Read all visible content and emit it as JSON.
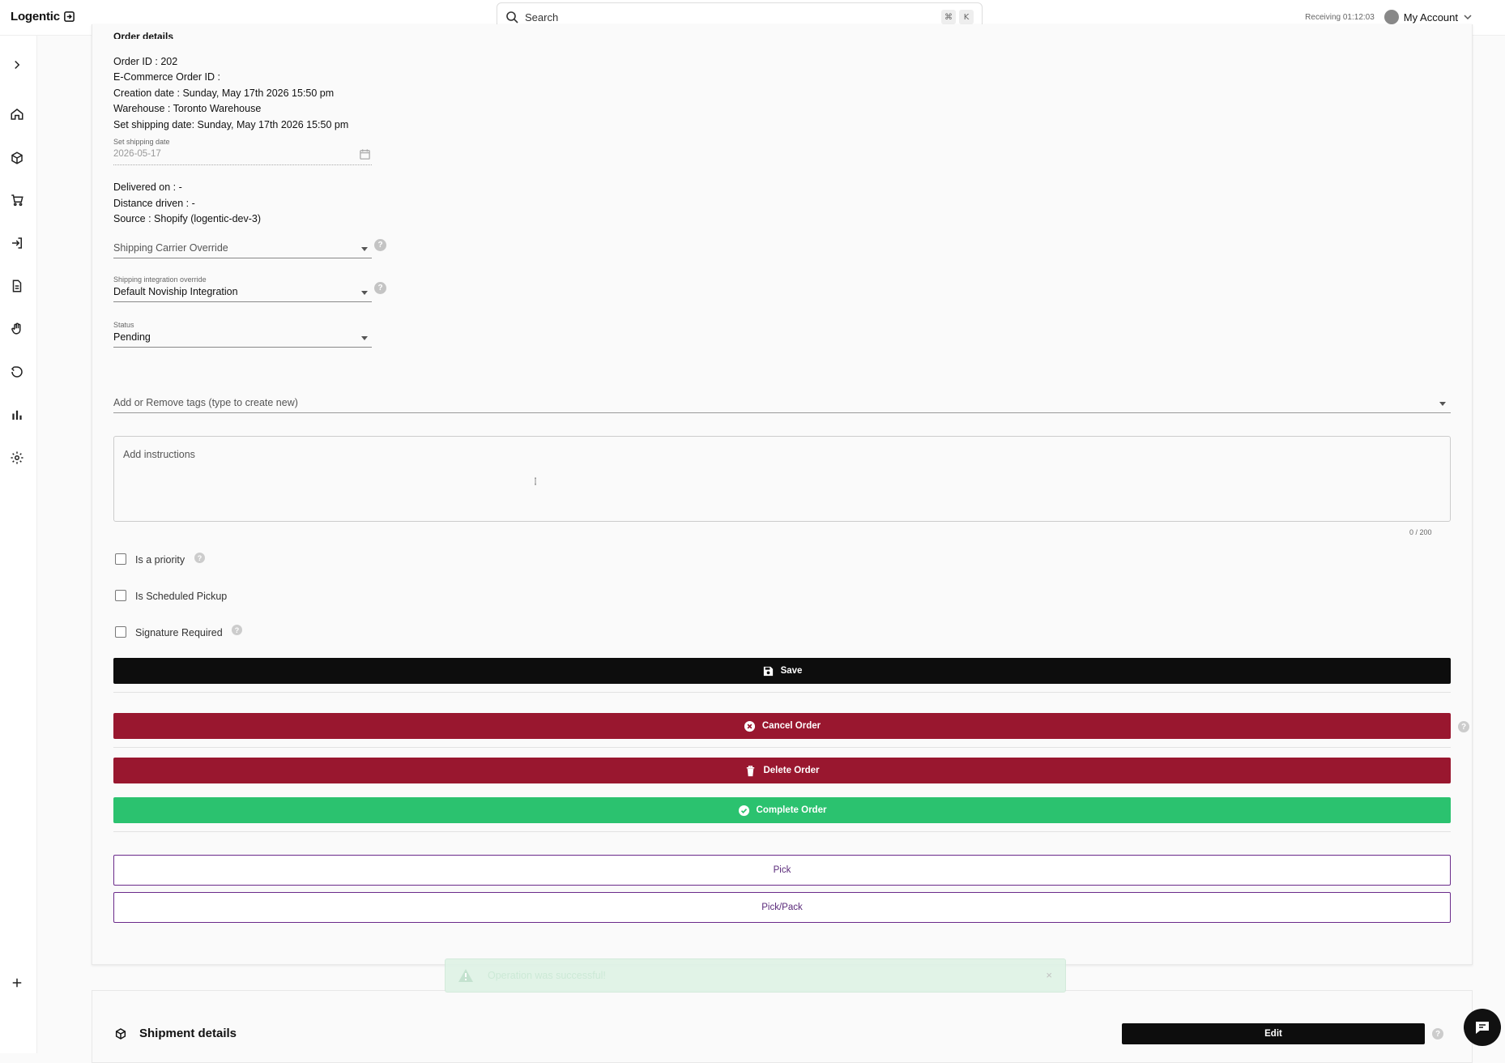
{
  "app": {
    "name": "Logentic"
  },
  "search": {
    "placeholder": "Search",
    "shortcut_cmd": "⌘",
    "shortcut_key": "K"
  },
  "header": {
    "receiving_label": "Receiving",
    "timer": "01:12:03",
    "account_label": "My Account"
  },
  "sidebar": {
    "items": [
      {
        "name": "expand",
        "icon": "chevron-right-icon"
      },
      {
        "name": "home",
        "icon": "home-icon"
      },
      {
        "name": "products",
        "icon": "box-icon"
      },
      {
        "name": "orders",
        "icon": "cart-icon"
      },
      {
        "name": "receiving",
        "icon": "login-icon"
      },
      {
        "name": "documents",
        "icon": "document-icon"
      },
      {
        "name": "picking",
        "icon": "hand-icon"
      },
      {
        "name": "returns",
        "icon": "undo-icon"
      },
      {
        "name": "reports",
        "icon": "bar-chart-icon"
      },
      {
        "name": "settings",
        "icon": "gear-icon"
      },
      {
        "name": "add",
        "icon": "plus-icon"
      }
    ]
  },
  "order": {
    "section_title": "Order details",
    "order_id": "Order ID : 202",
    "ecommerce_id": "E-Commerce Order ID :",
    "creation_date": "Creation date : Sunday, May 17th 2026 15:50 pm",
    "warehouse": "Warehouse : Toronto Warehouse",
    "set_shipping_date": "Set shipping date: Sunday, May 17th 2026 15:50 pm",
    "shipping_date_field": {
      "label": "Set shipping date",
      "value": "2026-05-17"
    },
    "delivered_on": "Delivered on : -",
    "distance_driven": "Distance driven : -",
    "source": "Source : Shopify (logentic-dev-3)",
    "carrier_override": {
      "placeholder": "Shipping Carrier Override"
    },
    "integration_override": {
      "label": "Shipping integration override",
      "value": "Default Noviship Integration"
    },
    "status": {
      "label": "Status",
      "value": "Pending"
    },
    "tags": {
      "placeholder": "Add or Remove tags (type to create new)"
    },
    "instructions": {
      "placeholder": "Add instructions",
      "counter": "0 / 200"
    },
    "checkboxes": {
      "priority": "Is a priority",
      "scheduled_pickup": "Is Scheduled Pickup",
      "signature": "Signature Required"
    },
    "buttons": {
      "save": "Save",
      "cancel": "Cancel Order",
      "delete": "Delete Order",
      "complete": "Complete Order",
      "pick": "Pick",
      "pick_pack": "Pick/Pack"
    }
  },
  "toast": {
    "message": "Operation was successful!",
    "close": "×"
  },
  "shipment": {
    "title": "Shipment details",
    "edit_label": "Edit"
  },
  "help_glyph": "?",
  "colors": {
    "danger": "#99172f",
    "success": "#2bc26f",
    "primary": "#0d0d0d",
    "outline": "#6a2a8a"
  }
}
